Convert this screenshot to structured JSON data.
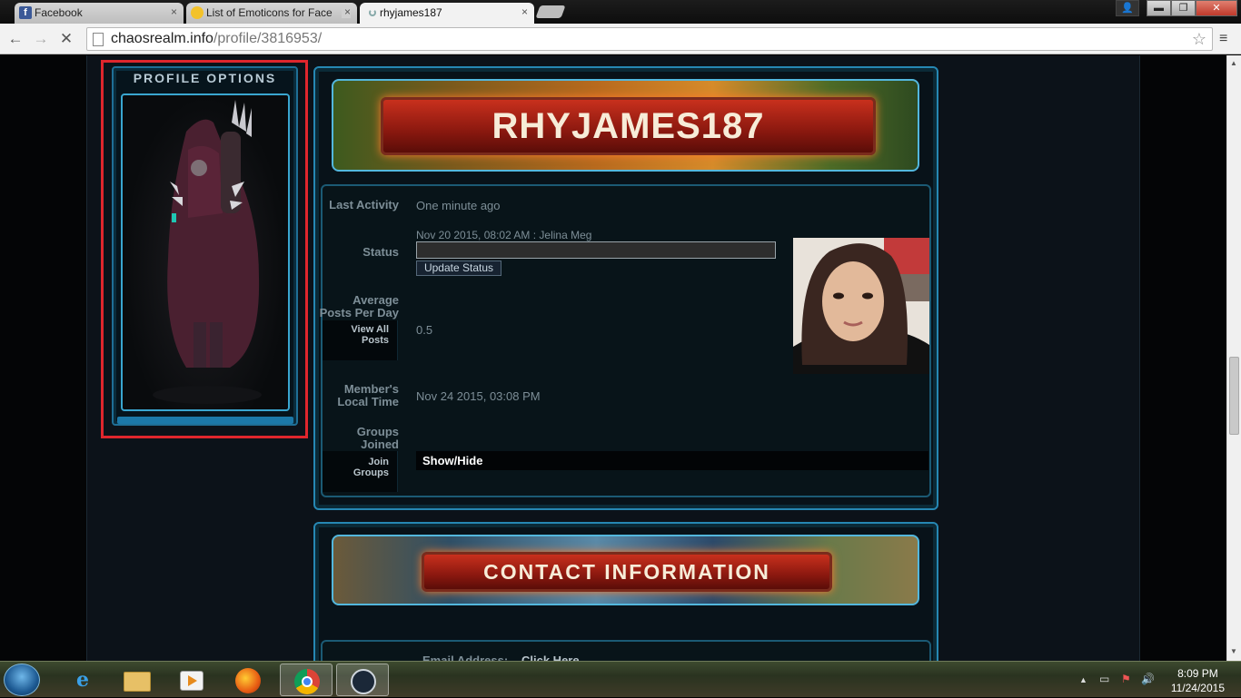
{
  "browser": {
    "tabs": [
      {
        "title": "Facebook",
        "favicon": "facebook-icon",
        "color": "#3b5998"
      },
      {
        "title": "List of Emoticons for Face",
        "favicon": "smiley-icon",
        "color": "#f3c22a"
      },
      {
        "title": "rhyjames187",
        "favicon": "loading-icon",
        "color": "#8aa"
      }
    ],
    "tab_close": "×",
    "address": {
      "host": "chaosrealm.info",
      "path": "/profile/3816953/"
    },
    "back": "←",
    "forward": "→",
    "reload": "✕",
    "star": "☆",
    "menu": "≡",
    "window": {
      "minimize": "▬",
      "maximize": "❐",
      "close": "✕",
      "user": "👤"
    }
  },
  "profile_options": {
    "title": "PROFILE OPTIONS"
  },
  "profile": {
    "username": "RHYJAMES187",
    "rows": {
      "last_activity": {
        "label": "Last Activity",
        "value": "One minute ago"
      },
      "status": {
        "label": "Status",
        "value": "Nov 20 2015, 08:02 AM : Jelina Meg",
        "button": "Update Status"
      },
      "avg_posts": {
        "label_1": "Average",
        "label_2": "Posts Per Day",
        "value": "0.5",
        "button_1": "View All",
        "button_2": "Posts"
      },
      "local_time": {
        "label_1": "Member's",
        "label_2": "Local Time",
        "value": "Nov 24 2015, 03:08 PM"
      },
      "groups": {
        "label_1": "Groups",
        "label_2": "Joined",
        "button_1": "Join",
        "button_2": "Groups",
        "toggle": "Show/Hide"
      }
    }
  },
  "contact": {
    "title": "CONTACT INFORMATION",
    "email_label": "Email Address:",
    "email_value": "Click Here"
  },
  "taskbar": {
    "clock_time": "8:09 PM",
    "clock_date": "11/24/2015",
    "tray": {
      "up": "▲",
      "network": "▭",
      "flag": "⚑",
      "volume": "🔊"
    }
  },
  "colors": {
    "accent": "#2687b3",
    "highlight": "#e0262d",
    "banner_red": "#c8301d"
  }
}
